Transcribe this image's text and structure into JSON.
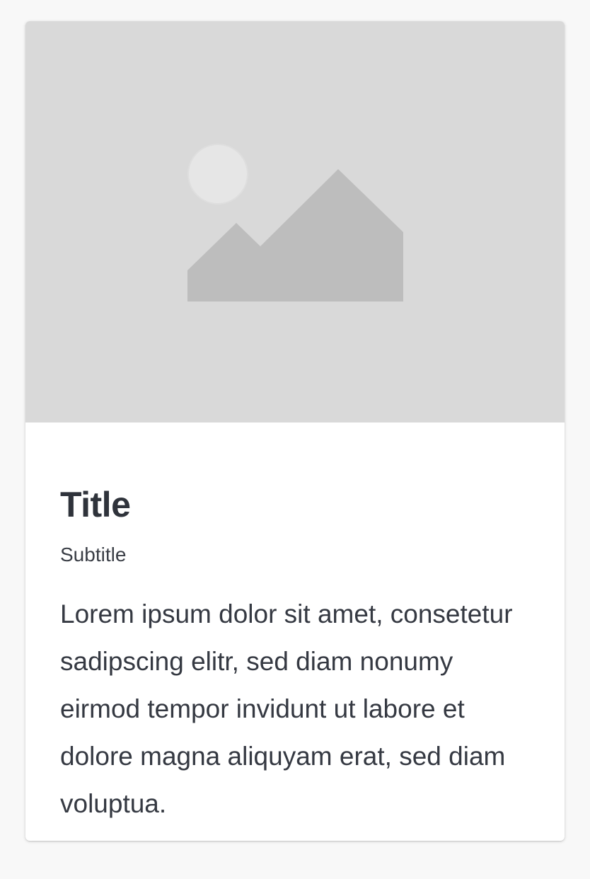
{
  "card": {
    "image_icon": "image-placeholder-icon",
    "title": "Title",
    "subtitle": "Subtitle",
    "body": "Lorem ipsum dolor sit amet, consetetur sadipscing elitr, sed diam nonumy eirmod tempor invidunt ut labore et dolore magna aliquyam erat, sed diam voluptua."
  },
  "colors": {
    "page_background": "#f8f8f8",
    "card_background": "#ffffff",
    "media_background": "#d9d9d9",
    "icon_shape": "#bdbdbd",
    "icon_sun": "#e6e6e6",
    "text": "#31353e"
  }
}
